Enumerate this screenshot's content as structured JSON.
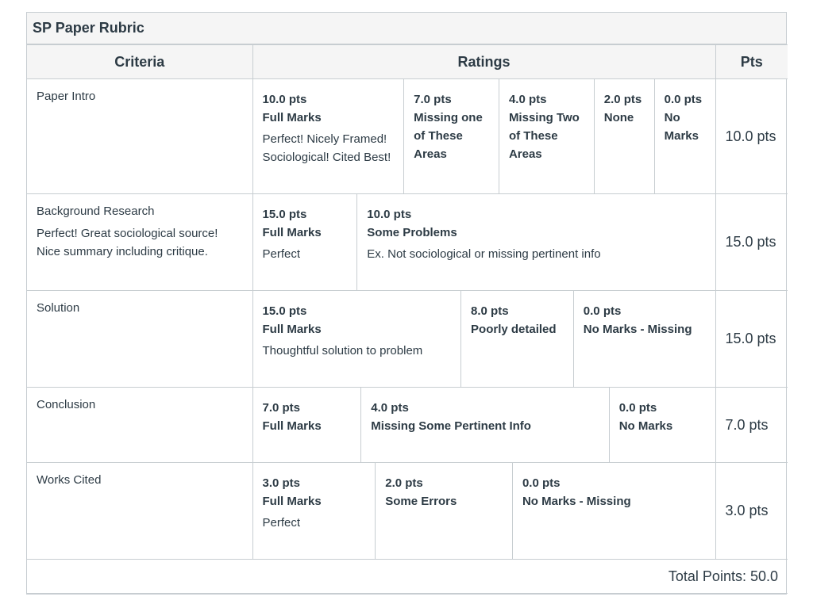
{
  "rubric": {
    "title": "SP Paper Rubric",
    "headers": {
      "criteria": "Criteria",
      "ratings": "Ratings",
      "pts": "Pts"
    },
    "rows": [
      {
        "criterion": "Paper Intro",
        "description": "",
        "points": "10.0 pts",
        "ratings": [
          {
            "pts": "10.0 pts",
            "name": "Full Marks",
            "desc": "Perfect! Nicely Framed! Sociological! Cited Best!"
          },
          {
            "pts": "7.0 pts",
            "name": "Missing one of These Areas",
            "desc": ""
          },
          {
            "pts": "4.0 pts",
            "name": "Missing Two of These Areas",
            "desc": ""
          },
          {
            "pts": "2.0 pts",
            "name": "None",
            "desc": ""
          },
          {
            "pts": "0.0 pts",
            "name": "No Marks",
            "desc": ""
          }
        ]
      },
      {
        "criterion": "Background Research",
        "description": "Perfect! Great sociological source! Nice summary including critique.",
        "points": "15.0 pts",
        "ratings": [
          {
            "pts": "15.0 pts",
            "name": "Full Marks",
            "desc": "Perfect"
          },
          {
            "pts": "10.0 pts",
            "name": "Some Problems",
            "desc": "Ex. Not sociological or missing pertinent info"
          }
        ]
      },
      {
        "criterion": "Solution",
        "description": "",
        "points": "15.0 pts",
        "ratings": [
          {
            "pts": "15.0 pts",
            "name": "Full Marks",
            "desc": "Thoughtful solution to problem"
          },
          {
            "pts": "8.0 pts",
            "name": "Poorly detailed",
            "desc": ""
          },
          {
            "pts": "0.0 pts",
            "name": "No Marks - Missing",
            "desc": ""
          }
        ]
      },
      {
        "criterion": "Conclusion",
        "description": "",
        "points": "7.0 pts",
        "ratings": [
          {
            "pts": "7.0 pts",
            "name": "Full Marks",
            "desc": ""
          },
          {
            "pts": "4.0 pts",
            "name": "Missing Some Pertinent Info",
            "desc": ""
          },
          {
            "pts": "0.0 pts",
            "name": "No Marks",
            "desc": ""
          }
        ]
      },
      {
        "criterion": "Works Cited",
        "description": "",
        "points": "3.0 pts",
        "ratings": [
          {
            "pts": "3.0 pts",
            "name": "Full Marks",
            "desc": "Perfect"
          },
          {
            "pts": "2.0 pts",
            "name": "Some Errors",
            "desc": ""
          },
          {
            "pts": "0.0 pts",
            "name": "No Marks - Missing",
            "desc": ""
          }
        ]
      }
    ],
    "total": "Total Points: 50.0"
  }
}
